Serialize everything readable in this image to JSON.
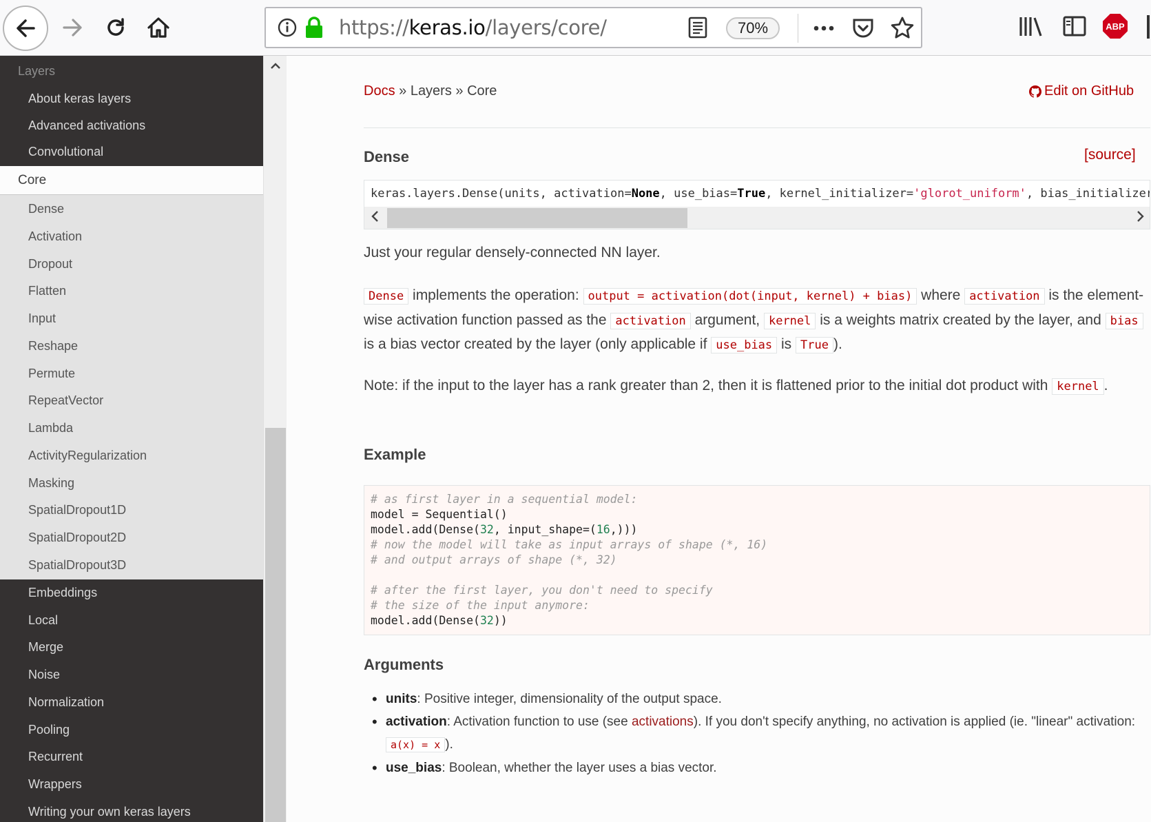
{
  "browser": {
    "url_prefix": "https://",
    "url_domain": "keras.io",
    "url_path": "/layers/core/",
    "zoom": "70%",
    "abp_label": "ABP"
  },
  "sidebar": {
    "caption": "Layers",
    "items_top": [
      "About keras layers",
      "Advanced activations",
      "Convolutional"
    ],
    "current": "Core",
    "subitems": [
      "Dense",
      "Activation",
      "Dropout",
      "Flatten",
      "Input",
      "Reshape",
      "Permute",
      "RepeatVector",
      "Lambda",
      "ActivityRegularization",
      "Masking",
      "SpatialDropout1D",
      "SpatialDropout2D",
      "SpatialDropout3D"
    ],
    "items_bottom": [
      "Embeddings",
      "Local",
      "Merge",
      "Noise",
      "Normalization",
      "Pooling",
      "Recurrent",
      "Wrappers",
      "Writing your own keras layers"
    ]
  },
  "content": {
    "breadcrumb_docs": "Docs",
    "breadcrumb_rest": " » Layers » Core",
    "edit_link": "Edit on GitHub",
    "dense_heading": "Dense",
    "source_link": "[source]",
    "signature": {
      "p1": "keras.layers.Dense(units, activation=",
      "none": "None",
      "p2": ", use_bias=",
      "true": "True",
      "p3": ", kernel_initializer=",
      "str1": "'glorot_uniform'",
      "p4": ", bias_initializer="
    },
    "intro": "Just your regular densely-connected NN layer.",
    "impl": {
      "dense": "Dense",
      "t1": " implements the operation: ",
      "op": "output = activation(dot(input, kernel) + bias)",
      "t2": " where ",
      "activation": "activation",
      "t3": " is the element-wise activation function passed as the ",
      "activation2": "activation",
      "t4": " argument, ",
      "kernel": "kernel",
      "t5": " is a weights matrix created by the layer, and ",
      "bias": "bias",
      "t6": " is a bias vector created by the layer (only applicable if ",
      "use_bias": "use_bias",
      "t7": " is ",
      "true": "True",
      "t8": ")."
    },
    "note": {
      "t1": "Note: if the input to the layer has a rank greater than 2, then it is flattened prior to the initial dot product with ",
      "kernel": "kernel",
      "t2": "."
    },
    "example_heading": "Example",
    "code": {
      "l1": "# as first layer in a sequential model:",
      "l2": "model = Sequential()",
      "l3a": "model.add(Dense(",
      "l3n1": "32",
      "l3b": ", input_shape=(",
      "l3n2": "16",
      "l3c": ",)))",
      "l4": "# now the model will take as input arrays of shape (*, 16)",
      "l5": "# and output arrays of shape (*, 32)",
      "l7": "# after the first layer, you don't need to specify",
      "l8": "# the size of the input anymore:",
      "l9a": "model.add(Dense(",
      "l9n": "32",
      "l9b": "))"
    },
    "arguments_heading": "Arguments",
    "args": {
      "units_name": "units",
      "units_desc": ": Positive integer, dimensionality of the output space.",
      "act_name": "activation",
      "act_desc1": ": Activation function to use (see ",
      "act_link": "activations",
      "act_desc2": "). If you don't specify anything, no activation is applied (ie. \"linear\" activation: ",
      "act_code": "a(x) = x",
      "act_desc3": ").",
      "bias_name": "use_bias",
      "bias_desc": ": Boolean, whether the layer uses a bias vector."
    }
  }
}
